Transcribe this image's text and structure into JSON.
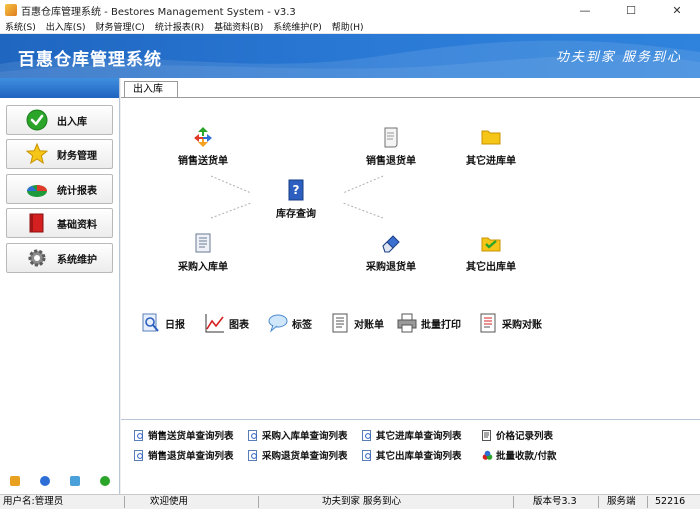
{
  "window": {
    "title": "百惠仓库管理系统 - Bestores Management System - v3.3",
    "minimize": "—",
    "maximize": "☐",
    "close": "✕"
  },
  "menu": [
    "系统(S)",
    "出入库(S)",
    "财务管理(C)",
    "统计报表(R)",
    "基础资料(B)",
    "系统维护(P)",
    "帮助(H)"
  ],
  "banner": {
    "title": "百惠仓库管理系统",
    "slogan": "功夫到家 服务到心"
  },
  "sidebar": {
    "items": [
      {
        "label": "出入库",
        "icon": "check-circle-icon"
      },
      {
        "label": "财务管理",
        "icon": "star-icon"
      },
      {
        "label": "统计报表",
        "icon": "pie-chart-icon"
      },
      {
        "label": "基础资料",
        "icon": "book-icon"
      },
      {
        "label": "系统维护",
        "icon": "gear-icon"
      }
    ]
  },
  "content": {
    "tab": "出入库",
    "flow": {
      "sales_delivery": "销售送货单",
      "sales_return": "销售退货单",
      "other_in": "其它进库单",
      "inventory_query": "库存查询",
      "purchase_in": "采购入库单",
      "purchase_return": "采购退货单",
      "other_out": "其它出库单"
    },
    "tools": {
      "daily": "日报",
      "chart": "图表",
      "label": "标签",
      "statement": "对账单",
      "batch_print": "批量打印",
      "purchase_reconcile": "采购对账"
    },
    "links": {
      "row1": [
        "销售送货单查询列表",
        "采购入库单查询列表",
        "其它进库单查询列表",
        "价格记录列表"
      ],
      "row2": [
        "销售退货单查询列表",
        "采购退货单查询列表",
        "其它出库单查询列表",
        "批量收款/付款"
      ]
    }
  },
  "statusbar": {
    "user": "用户名:管理员",
    "welcome": "欢迎使用",
    "slogan": "功夫到家 服务到心",
    "version": "版本号3.3",
    "edition": "服务端",
    "port": "52216"
  },
  "colors": {
    "banner": "#2a7ad6",
    "sidebar_head": "#1f63bf",
    "accent_green": "#2aa52a"
  }
}
